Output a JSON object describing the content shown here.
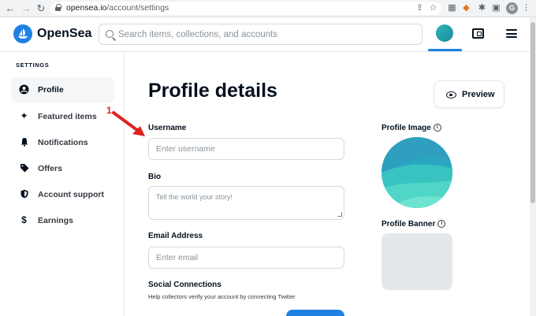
{
  "browser": {
    "url_domain": "opensea.io",
    "url_path": "/account/settings",
    "profile_initial": "G"
  },
  "header": {
    "logo_text": "OpenSea",
    "search_placeholder": "Search items, collections, and accounts"
  },
  "sidebar": {
    "heading": "SETTINGS",
    "items": [
      {
        "label": "Profile",
        "icon": "person-icon",
        "active": true
      },
      {
        "label": "Featured items",
        "icon": "sparkle-icon",
        "active": false
      },
      {
        "label": "Notifications",
        "icon": "bell-icon",
        "active": false
      },
      {
        "label": "Offers",
        "icon": "tag-icon",
        "active": false
      },
      {
        "label": "Account support",
        "icon": "shield-icon",
        "active": false
      },
      {
        "label": "Earnings",
        "icon": "dollar-icon",
        "active": false
      }
    ]
  },
  "main": {
    "title": "Profile details",
    "preview_label": "Preview",
    "username": {
      "label": "Username",
      "placeholder": "Enter username",
      "value": ""
    },
    "bio": {
      "label": "Bio",
      "placeholder": "Tell the world your story!",
      "value": ""
    },
    "email": {
      "label": "Email Address",
      "placeholder": "Enter email",
      "value": ""
    },
    "social": {
      "label": "Social Connections",
      "helper": "Help collectors verify your account by connecting Twitter"
    },
    "profile_image_label": "Profile Image",
    "profile_banner_label": "Profile Banner"
  },
  "annotation": {
    "number": "1",
    "color": "#e02020"
  },
  "colors": {
    "accent": "#2081e2",
    "text": "#04111d",
    "border": "#d6dadf"
  }
}
